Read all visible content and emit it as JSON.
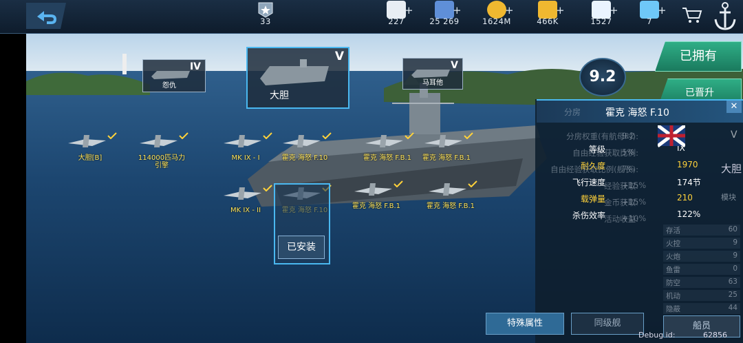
{
  "topbar": {
    "rank": "33",
    "resources": [
      {
        "icon": "heart-icon",
        "value": "227"
      },
      {
        "icon": "card-icon",
        "value": "25 269"
      },
      {
        "icon": "coin-icon",
        "value": "1624M"
      },
      {
        "icon": "star-icon",
        "value": "466K"
      },
      {
        "icon": "diamond-icon",
        "value": "1527"
      },
      {
        "icon": "crystal-icon",
        "value": "7"
      }
    ],
    "plus": "+"
  },
  "ships": {
    "left": {
      "tier": "IV",
      "name": "怨仇"
    },
    "center": {
      "tier": "V",
      "name": "大胆"
    },
    "right": {
      "tier": "V",
      "name": "马耳他"
    }
  },
  "rating": "9.2",
  "tabs": {
    "owned": "已拥有",
    "promoted": "已晋升"
  },
  "slots": [
    {
      "label": "大胆[B]"
    },
    {
      "label": "114000匹马力\n引擎"
    },
    {
      "label": "MK IX - I"
    },
    {
      "label": "霍克 海怒 F.10"
    },
    {
      "label": "霍克 海怒 F.B.1"
    },
    {
      "label": "霍克 海怒 F.B.1"
    },
    {
      "label": "MK IX - II"
    },
    {
      "label": "霍克 海怒 F.10"
    },
    {
      "label": "霍克 海怒 F.B.1"
    },
    {
      "label": "霍克 海怒 F.B.1"
    }
  ],
  "installed_label": "已安装",
  "popup": {
    "title": "霍克 海怒 F.10",
    "stats": [
      {
        "label": "等级",
        "value": "IX"
      },
      {
        "label": "耐久度",
        "value": "1970"
      },
      {
        "label": "飞行速度",
        "value": "174节"
      },
      {
        "label": "载弹量",
        "value": "210"
      },
      {
        "label": "杀伤效率",
        "value": "122%"
      }
    ],
    "close": "✕"
  },
  "ghost_rows": [
    {
      "label": "分房权重(有航母时):",
      "value": "9.2"
    },
    {
      "label": "自由经验获取比例:",
      "value": "5%"
    },
    {
      "label": "自由经验获取比例(舰长):",
      "value": "7%"
    },
    {
      "label": "经验获取:",
      "value": "+15%"
    },
    {
      "label": "金币获取:",
      "value": "+15%"
    },
    {
      "label": "活动收益:",
      "value": "+10%"
    }
  ],
  "side_stats": [
    {
      "label": "存活",
      "value": "60"
    },
    {
      "label": "火控",
      "value": "9"
    },
    {
      "label": "火炮",
      "value": "9"
    },
    {
      "label": "鱼雷",
      "value": "0"
    },
    {
      "label": "防空",
      "value": "63"
    },
    {
      "label": "机动",
      "value": "25"
    },
    {
      "label": "隐蔽",
      "value": "44"
    }
  ],
  "side_misc": {
    "ship_short": "大胆",
    "module": "模块",
    "roman": "V",
    "header": "分房",
    "crew": "船员"
  },
  "bottom": {
    "special": "特殊属性",
    "same_level": "同级舰",
    "debug_label": "Debug id:",
    "debug_value": "62856"
  }
}
